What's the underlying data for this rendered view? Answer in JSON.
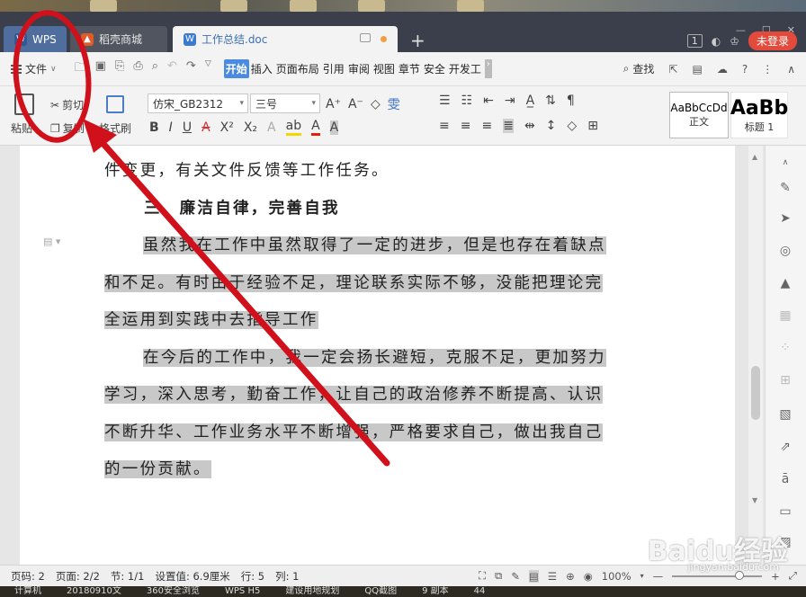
{
  "tabs": [
    {
      "label": "WPS",
      "icon": "wps-logo-icon"
    },
    {
      "label": "稻壳商城",
      "icon": "flame-icon"
    },
    {
      "label": "工作总结.doc",
      "icon": "doc-icon"
    }
  ],
  "titlebar": {
    "badge_count": "1",
    "login_label": "未登录"
  },
  "menu": {
    "file_label": "文件",
    "tabs": [
      "开始",
      "插入",
      "页面布局",
      "引用",
      "审阅",
      "视图",
      "章节",
      "安全",
      "开发工"
    ],
    "search_label": "查找"
  },
  "ribbon": {
    "paste_label": "粘贴",
    "cut_label": "剪切",
    "copy_label": "复制",
    "format_painter_label": "格式刷",
    "font_name": "仿宋_GB2312",
    "font_size": "三号",
    "styles": [
      {
        "preview": "AaBbCcDd",
        "name": "正文"
      },
      {
        "preview": "AaBb",
        "name": "标题 1"
      }
    ]
  },
  "document": {
    "lines": [
      "件变更，有关文件反馈等工作任务。",
      "三、廉洁自律，完善自我",
      "虽然我在工作中虽然取得了一定的进步，但是也存在着缺点",
      "和不足。有时由于经验不足，理论联系实际不够，没能把理论完",
      "全运用到实践中去指导工作",
      "在今后的工作中，我一定会扬长避短，克服不足，更加努力",
      "学习，深入思考，勤奋工作，让自己的政治修养不断提高、认识",
      "不断升华、工作业务水平不断增强，严格要求自己，做出我自己",
      "的一份贡献。"
    ]
  },
  "status": {
    "page_no": "页码: 2",
    "pages": "页面: 2/2",
    "section": "节: 1/1",
    "setting": "设置值: 6.9厘米",
    "row": "行: 5",
    "col": "列: 1",
    "zoom": "100%"
  },
  "taskbar": [
    "计算机",
    "20180910文",
    "360安全浏览",
    "WPS H5",
    "建设用地规划",
    "QQ截图",
    "9 副本",
    "44"
  ],
  "watermark": {
    "text": "Baidu经验",
    "sub": "jingyan.baidu.com"
  },
  "annotation_color": "#d0101a"
}
